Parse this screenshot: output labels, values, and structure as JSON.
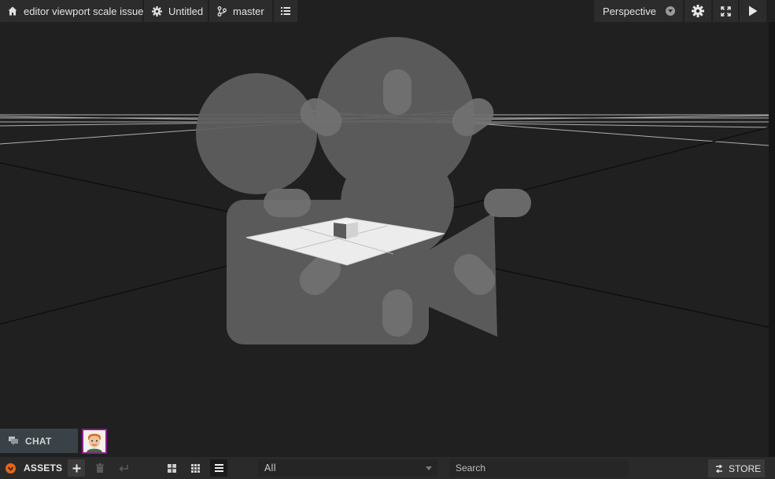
{
  "topbar": {
    "project_title": "editor viewport scale issue",
    "scene_name": "Untitled",
    "branch": "master",
    "camera_mode": "Perspective",
    "icons": [
      "home-icon",
      "gear-icon",
      "branch-icon",
      "list-icon",
      "settings-icon",
      "fullscreen-icon",
      "play-icon"
    ]
  },
  "chat": {
    "label": "CHAT"
  },
  "assets": {
    "label": "ASSETS",
    "filter_value": "All",
    "search_placeholder": "Search",
    "store_label": "STORE"
  },
  "colors": {
    "background": "#202020",
    "panel": "#2c2c2c",
    "accent_orange": "#e8651a",
    "avatar_border": "#8e1b8e",
    "chat_bg": "#3a4248"
  }
}
